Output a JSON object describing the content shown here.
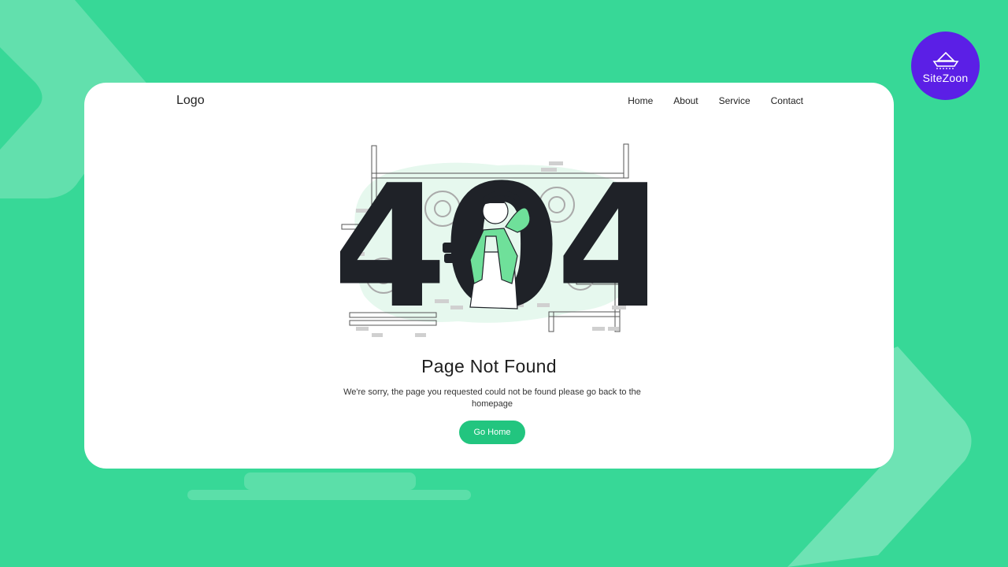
{
  "brand": {
    "name": "SiteZoon",
    "icon": "boat-icon"
  },
  "nav": {
    "logo": "Logo",
    "links": [
      "Home",
      "About",
      "Service",
      "Contact"
    ]
  },
  "error": {
    "code": "404",
    "title": "Page Not Found",
    "message": "We're sorry, the page you requested could not be found please go back to the homepage",
    "button_label": "Go Home"
  },
  "colors": {
    "background": "#37d897",
    "accent": "#22c57f",
    "brand_badge": "#5b1fe6",
    "digits": "#1f2228"
  }
}
